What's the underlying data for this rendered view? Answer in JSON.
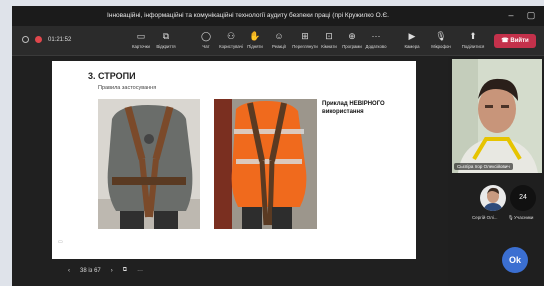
{
  "window": {
    "title": "Інноваційні, інформаційні та комунікаційні технології аудиту безпеки праці (прі Кружилко О.Є."
  },
  "toolbar": {
    "timer": "01:21:52",
    "items": [
      {
        "label": "Карточки",
        "icon": "chat-bubble-icon"
      },
      {
        "label": "Відкриття",
        "icon": "open-icon"
      },
      {
        "label": "Чат",
        "icon": "chat-icon"
      },
      {
        "label": "Користувачі",
        "icon": "people-icon"
      },
      {
        "label": "Підняти",
        "icon": "hand-icon"
      },
      {
        "label": "Реакції",
        "icon": "smile-icon"
      },
      {
        "label": "Переглянути",
        "icon": "grid-icon"
      },
      {
        "label": "Кімнати",
        "icon": "rooms-icon"
      },
      {
        "label": "Програми",
        "icon": "apps-icon"
      },
      {
        "label": "Додатково",
        "icon": "more-icon"
      },
      {
        "label": "Камера",
        "icon": "camera-icon"
      },
      {
        "label": "Мікрофон",
        "icon": "mic-icon"
      },
      {
        "label": "Поділитися",
        "icon": "share-icon"
      }
    ],
    "exit_label": "Вийти"
  },
  "slide": {
    "heading": "3. СТРОПИ",
    "subheading": "Правила застосування",
    "note": "Приклад НЕВІРНОГО використання",
    "page_indicator": "38 із 67"
  },
  "participants": {
    "main_name": "Сьєпіра Ігор Олексійович",
    "second_name": "Сергій Олі...",
    "count": "24",
    "count_label": "Учасники",
    "ok_label": "Ok"
  },
  "colors": {
    "exit_button": "#c4314b",
    "safety_vest": "#f06a1d",
    "ok_badge": "#3b6fd1"
  }
}
